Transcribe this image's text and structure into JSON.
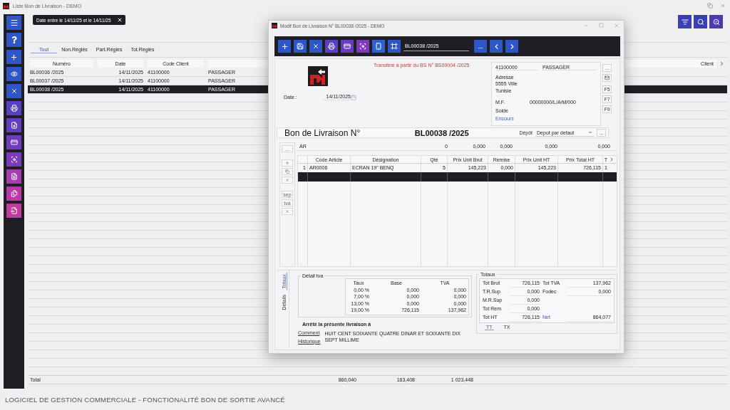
{
  "window": {
    "title": "Liste Bon de Livraison - DEMO"
  },
  "sidebar": {
    "items": [
      {
        "kind": "menu",
        "color": "#2f56c6"
      },
      {
        "kind": "help",
        "color": "#2f56c6"
      },
      {
        "kind": "add",
        "color": "#2f56c6"
      },
      {
        "kind": "view",
        "color": "#2f56c6"
      },
      {
        "kind": "close",
        "color": "#2f56c6"
      },
      {
        "kind": "print",
        "color": "#5840c2"
      },
      {
        "kind": "search-list",
        "color": "#633ec0"
      },
      {
        "kind": "card",
        "color": "#6e3cbd"
      },
      {
        "kind": "card-search",
        "color": "#7c3aba"
      },
      {
        "kind": "doc",
        "color": "#a63cae"
      },
      {
        "kind": "doc-list",
        "color": "#b93aa6"
      },
      {
        "kind": "doc-export",
        "color": "#c23c9e"
      }
    ]
  },
  "filter": {
    "label": "Date entre le 14/11/25 et le 14/11/25"
  },
  "toolbar_right": {
    "items": [
      {
        "kind": "filter",
        "color": "#3a3fb3"
      },
      {
        "kind": "search",
        "color": "#3a3fb3"
      },
      {
        "kind": "search-refresh",
        "color": "#4a3cb0"
      }
    ]
  },
  "tabs": [
    {
      "label": "Tout",
      "selected": true
    },
    {
      "label": "Non.Réglés",
      "selected": false
    },
    {
      "label": "Part.Réglés",
      "selected": false
    },
    {
      "label": "Tot.Réglés",
      "selected": false
    }
  ],
  "table": {
    "columns": [
      "Numéro",
      "Date",
      "Code Client",
      "Client"
    ],
    "rows": [
      {
        "cells": [
          "BL00036 /2025",
          "14/11/2025",
          "41100000",
          "PASSAGER"
        ],
        "selected": false
      },
      {
        "cells": [
          "BL00037 /2025",
          "14/11/2025",
          "41100000",
          "PASSAGER"
        ],
        "selected": false
      },
      {
        "cells": [
          "BL00038 /2025",
          "14/11/2025",
          "41100000",
          "PASSAGER"
        ],
        "selected": true
      }
    ],
    "total": {
      "label": "Total",
      "values": [
        "860,040",
        "163,408",
        "1 023,448"
      ]
    }
  },
  "status_bar": {
    "text": "LOGICIEL DE GESTION COMMERCIALE - FONCTIONALITÉ BON DE SORTIE AVANCÉ"
  },
  "dialog": {
    "title": "Modif  Bon de Livraison N° BL00038 /2025 - DEMO",
    "toolbar": {
      "buttons": [
        {
          "kind": "add",
          "color": "#2f56c6"
        },
        {
          "kind": "save",
          "color": "#2f56c6"
        },
        {
          "kind": "close",
          "color": "#2f56c6"
        },
        {
          "kind": "print",
          "color": "#5a40c2"
        },
        {
          "kind": "card",
          "color": "#6a3dbf"
        },
        {
          "kind": "card-search",
          "color": "#7c3aba"
        },
        {
          "kind": "phone",
          "color": "#2f62cc"
        },
        {
          "kind": "doc-frame",
          "color": "#2f56c6"
        }
      ],
      "number": "BL00038 /2025",
      "nav": [
        {
          "kind": "more",
          "label": "..."
        },
        {
          "kind": "prev"
        },
        {
          "kind": "next"
        }
      ]
    },
    "transfer_note": "Transféré à partir du BS N° BS00004 /2025",
    "date": {
      "label": "Date :",
      "value": "14/11/2025"
    },
    "client": {
      "code": "41100000",
      "name": "PASSAGER",
      "address_label": "Adresse",
      "address": [
        "5555  Ville",
        "Tunisie"
      ],
      "mf_label": "M.F.",
      "mf": "00000000/L/A/M/000",
      "solde_label": "Solde",
      "encours": "Encours",
      "buttons": [
        {
          "kind": "text",
          "label": "..."
        },
        {
          "kind": "mail"
        },
        {
          "kind": "text",
          "label": "F5"
        },
        {
          "kind": "text",
          "label": "F7"
        },
        {
          "kind": "text",
          "label": "F9"
        }
      ]
    },
    "heading": {
      "title": "Bon de Livraison N°",
      "number": "BL00038 /2025",
      "depot_label": "Dépôt",
      "depot": "Depot par defaut",
      "more": "..."
    },
    "line_tools": {
      "top": "...",
      "buttons": [
        {
          "kind": "add"
        },
        {
          "kind": "copy"
        },
        {
          "kind": "delete"
        },
        {
          "kind": "text",
          "label": "sep"
        },
        {
          "kind": "text",
          "label": "tva"
        },
        {
          "kind": "delete"
        }
      ]
    },
    "summary": [
      "AR",
      "0",
      "0,000",
      "0,000",
      "0,000",
      "0,000"
    ],
    "grid": {
      "columns": [
        "Code Article",
        "Désignation",
        "Qté",
        "Prix Unit Brut",
        "Remise",
        "Prix Unit HT",
        "Prix Total HT",
        "T"
      ],
      "rows": [
        {
          "number": "1",
          "cells": [
            "AR0006",
            "ECRAN 19\" BENQ",
            "5",
            "145,223",
            "0,000",
            "145,223",
            "726,115",
            "1"
          ],
          "selected": false
        },
        {
          "selected": true
        }
      ]
    },
    "side_tabs": [
      {
        "label": "Totaux",
        "selected": true
      },
      {
        "label": "Détails",
        "selected": false
      }
    ],
    "tva": {
      "title": "Détail tva",
      "columns": [
        "Taux",
        "Base",
        "TVA"
      ],
      "rows": [
        [
          "0,00 %",
          "0,000",
          "0,000"
        ],
        [
          "7,00 %",
          "0,000",
          "0,000"
        ],
        [
          "13,00 %",
          "0,000",
          "0,000"
        ],
        [
          "19,00 %",
          "726,115",
          "137,962"
        ]
      ]
    },
    "amount_words": {
      "title": "Arrêté la présente livraison à",
      "links": [
        "Comment",
        "Historique"
      ],
      "text": "HUIT CENT SOIXANTE QUATRE DINAR ET SOIXANTE DIX SEPT MILLIME"
    },
    "totals": {
      "title": "Totaux",
      "rows": [
        {
          "label": "Tot Brut",
          "value": "726,115",
          "right": {
            "label": "Tot TVA",
            "value": "137,962",
            "link": false
          }
        },
        {
          "label": "T.R.Sup",
          "value": "0,000",
          "right": {
            "label": "Fodec",
            "value": "0,000",
            "link": false
          }
        },
        {
          "label": "M.R.Sup",
          "value": "0,000"
        },
        {
          "label": "Tot Rem",
          "value": "0,000"
        },
        {
          "label": "Tot HT",
          "value": "726,115",
          "right": {
            "label": "Net",
            "value": "864,077",
            "link": true
          }
        }
      ],
      "tabs": [
        {
          "label": "TT",
          "selected": true
        },
        {
          "label": "TX",
          "selected": false
        }
      ]
    }
  }
}
